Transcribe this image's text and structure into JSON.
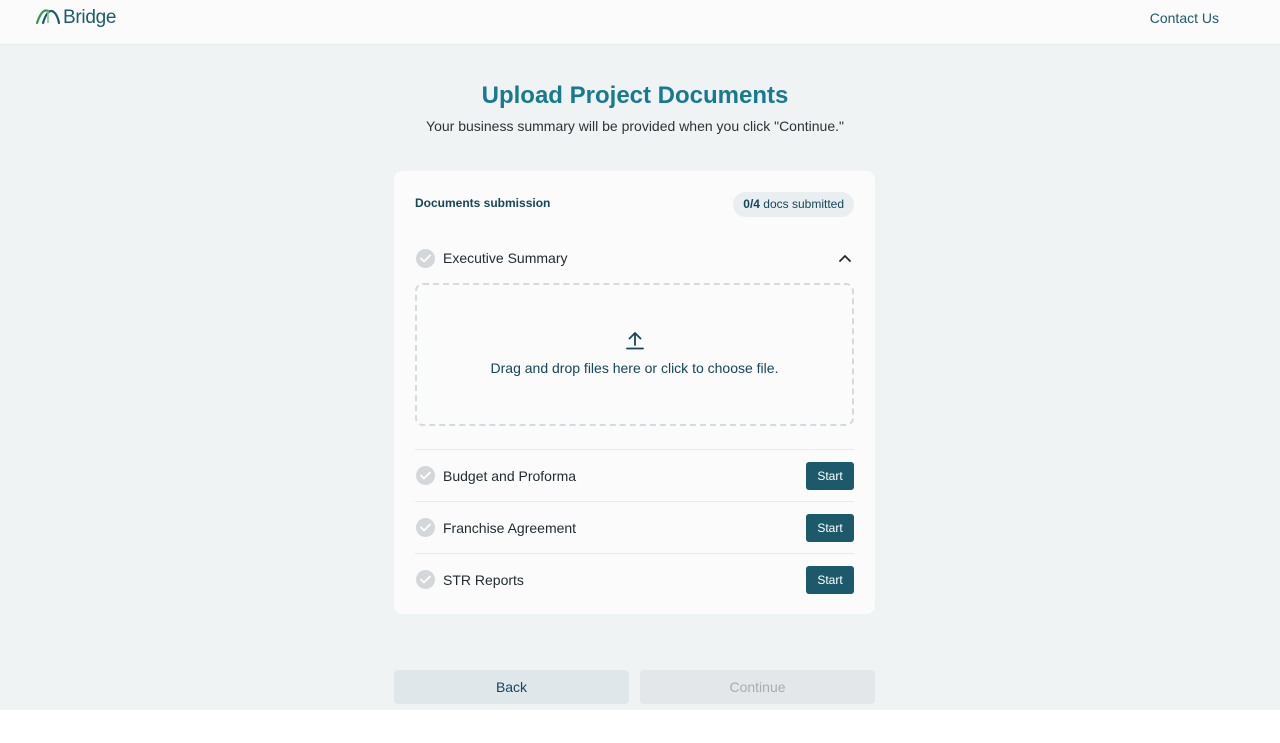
{
  "header": {
    "logo_text": "Bridge",
    "contact_label": "Contact Us"
  },
  "main": {
    "title": "Upload Project Documents",
    "subtitle": "Your business summary will be provided when you click \"Continue.\""
  },
  "card": {
    "title": "Documents submission",
    "badge_count": "0/4",
    "badge_suffix": " docs submitted",
    "documents": [
      {
        "label": "Executive Summary",
        "expanded": true
      },
      {
        "label": "Budget and Proforma",
        "action": "Start"
      },
      {
        "label": "Franchise Agreement",
        "action": "Start"
      },
      {
        "label": "STR Reports",
        "action": "Start"
      }
    ],
    "dropzone_text": "Drag and drop files here or click to choose file."
  },
  "footer": {
    "back_label": "Back",
    "continue_label": "Continue"
  },
  "icons": {
    "logo": "bridge-arch-icon",
    "check": "check-circle-icon",
    "chevron": "chevron-up-icon",
    "upload": "upload-icon"
  },
  "colors": {
    "brand": "#1d5a6e",
    "title": "#177a8f",
    "button": "#1c5a6b",
    "background": "#eff3f4"
  }
}
